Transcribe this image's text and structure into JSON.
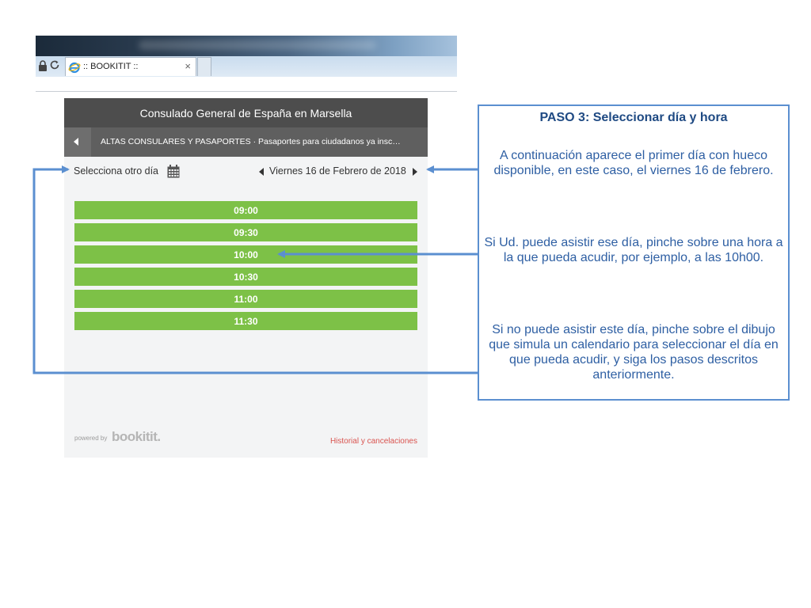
{
  "browser": {
    "tab_title": ":: BOOKITIT ::",
    "tab_close": "×"
  },
  "widget": {
    "header_title": "Consulado General de España en Marsella",
    "service_text": "ALTAS CONSULARES Y PASAPORTES · Pasaportes para ciudadanos ya insc…",
    "select_other_day": "Selecciona otro día",
    "date_label": "Viernes 16 de Febrero de 2018",
    "slots": [
      "09:00",
      "09:30",
      "10:00",
      "10:30",
      "11:00",
      "11:30"
    ],
    "powered_by": "powered by",
    "brand": "bookitit.",
    "history_link": "Historial y cancelaciones"
  },
  "note": {
    "title": "PASO 3: Seleccionar día y hora",
    "p1": "A continuación  aparece el primer día con hueco disponible, en este caso, el viernes 16 de febrero.",
    "p2": "Si Ud. puede asistir ese día, pinche  sobre una hora a la que pueda acudir, por ejemplo, a las 10h00.",
    "p3": "Si no puede asistir este día, pinche sobre el dibujo que simula un calendario para seleccionar el día en que pueda acudir, y siga los pasos descritos anteriormente."
  },
  "colors": {
    "slot_green": "#7dc147",
    "header_dark": "#4d4d4d",
    "note_blue": "#5b8fd0",
    "link_red": "#d9534f"
  }
}
